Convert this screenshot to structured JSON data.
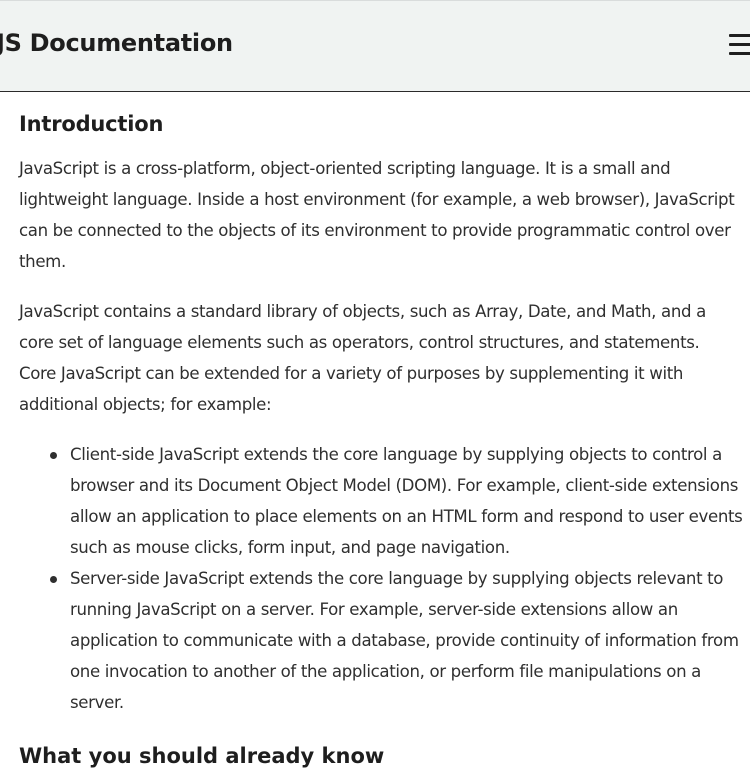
{
  "header": {
    "title": "JS Documentation",
    "menu_icon": "hamburger-menu-icon"
  },
  "main": {
    "section_title": "Introduction",
    "paragraphs": [
      "JavaScript is a cross-platform, object-oriented scripting language. It is a small and lightweight language. Inside a host environment (for example, a web browser), JavaScript can be connected to the objects of its environment to provide programmatic control over them.",
      "JavaScript contains a standard library of objects, such as Array, Date, and Math, and a core set of language elements such as operators, control structures, and statements. Core JavaScript can be extended for a variety of purposes by supplementing it with additional objects; for example:"
    ],
    "list_items": [
      "Client-side JavaScript extends the core language by supplying objects to control a browser and its Document Object Model (DOM). For example, client-side extensions allow an application to place elements on an HTML form and respond to user events such as mouse clicks, form input, and page navigation.",
      "Server-side JavaScript extends the core language by supplying objects relevant to running JavaScript on a server. For example, server-side extensions allow an application to communicate with a database, provide continuity of information from one invocation to another of the application, or perform file manipulations on a server."
    ],
    "next_section_title": "What you should already know"
  }
}
